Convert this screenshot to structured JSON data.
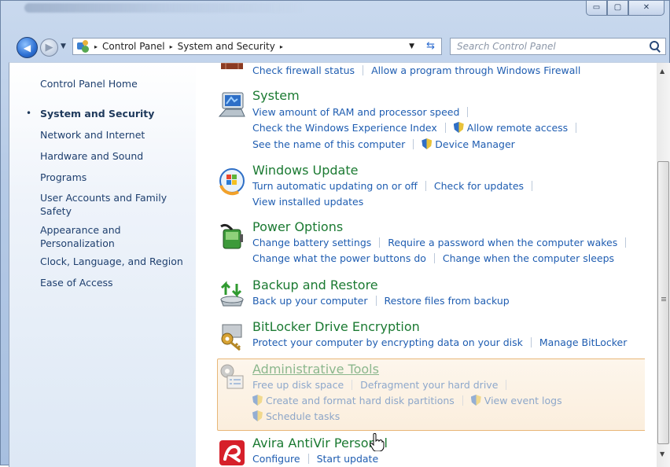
{
  "window": {
    "minimize_glyph": "▭",
    "maximize_glyph": "▢",
    "close_glyph": "✕"
  },
  "address_bar": {
    "crumbs": [
      "Control Panel",
      "System and Security"
    ],
    "separator": "▸",
    "search_placeholder": "Search Control Panel"
  },
  "nav_pane": {
    "home": "Control Panel Home",
    "bullet": "•",
    "items": [
      "System and Security",
      "Network and Internet",
      "Hardware and Sound",
      "Programs",
      "User Accounts and Family Safety",
      "Appearance and Personalization",
      "Clock, Language, and Region",
      "Ease of Access"
    ]
  },
  "categories": {
    "firewall": {
      "links": [
        "Check firewall status",
        "Allow a program through Windows Firewall"
      ]
    },
    "system": {
      "title": "System",
      "links": [
        "View amount of RAM and processor speed",
        "Check the Windows Experience Index",
        "Allow remote access",
        "See the name of this computer",
        "Device Manager"
      ]
    },
    "windows_update": {
      "title": "Windows Update",
      "links": [
        "Turn automatic updating on or off",
        "Check for updates",
        "View installed updates"
      ]
    },
    "power": {
      "title": "Power Options",
      "links": [
        "Change battery settings",
        "Require a password when the computer wakes",
        "Change what the power buttons do",
        "Change when the computer sleeps"
      ]
    },
    "backup": {
      "title": "Backup and Restore",
      "links": [
        "Back up your computer",
        "Restore files from backup"
      ]
    },
    "bitlocker": {
      "title": "BitLocker Drive Encryption",
      "links": [
        "Protect your computer by encrypting data on your disk",
        "Manage BitLocker"
      ]
    },
    "admin_tools": {
      "title": "Administrative Tools",
      "links": [
        "Free up disk space",
        "Defragment your hard drive",
        "Create and format hard disk partitions",
        "View event logs",
        "Schedule tasks"
      ]
    },
    "avira": {
      "title": "Avira AntiVir Personal",
      "links": [
        "Configure",
        "Start update"
      ]
    }
  },
  "colors": {
    "category_title": "#1b7a32",
    "link": "#1f5db1",
    "hover_border": "#e8b778"
  }
}
